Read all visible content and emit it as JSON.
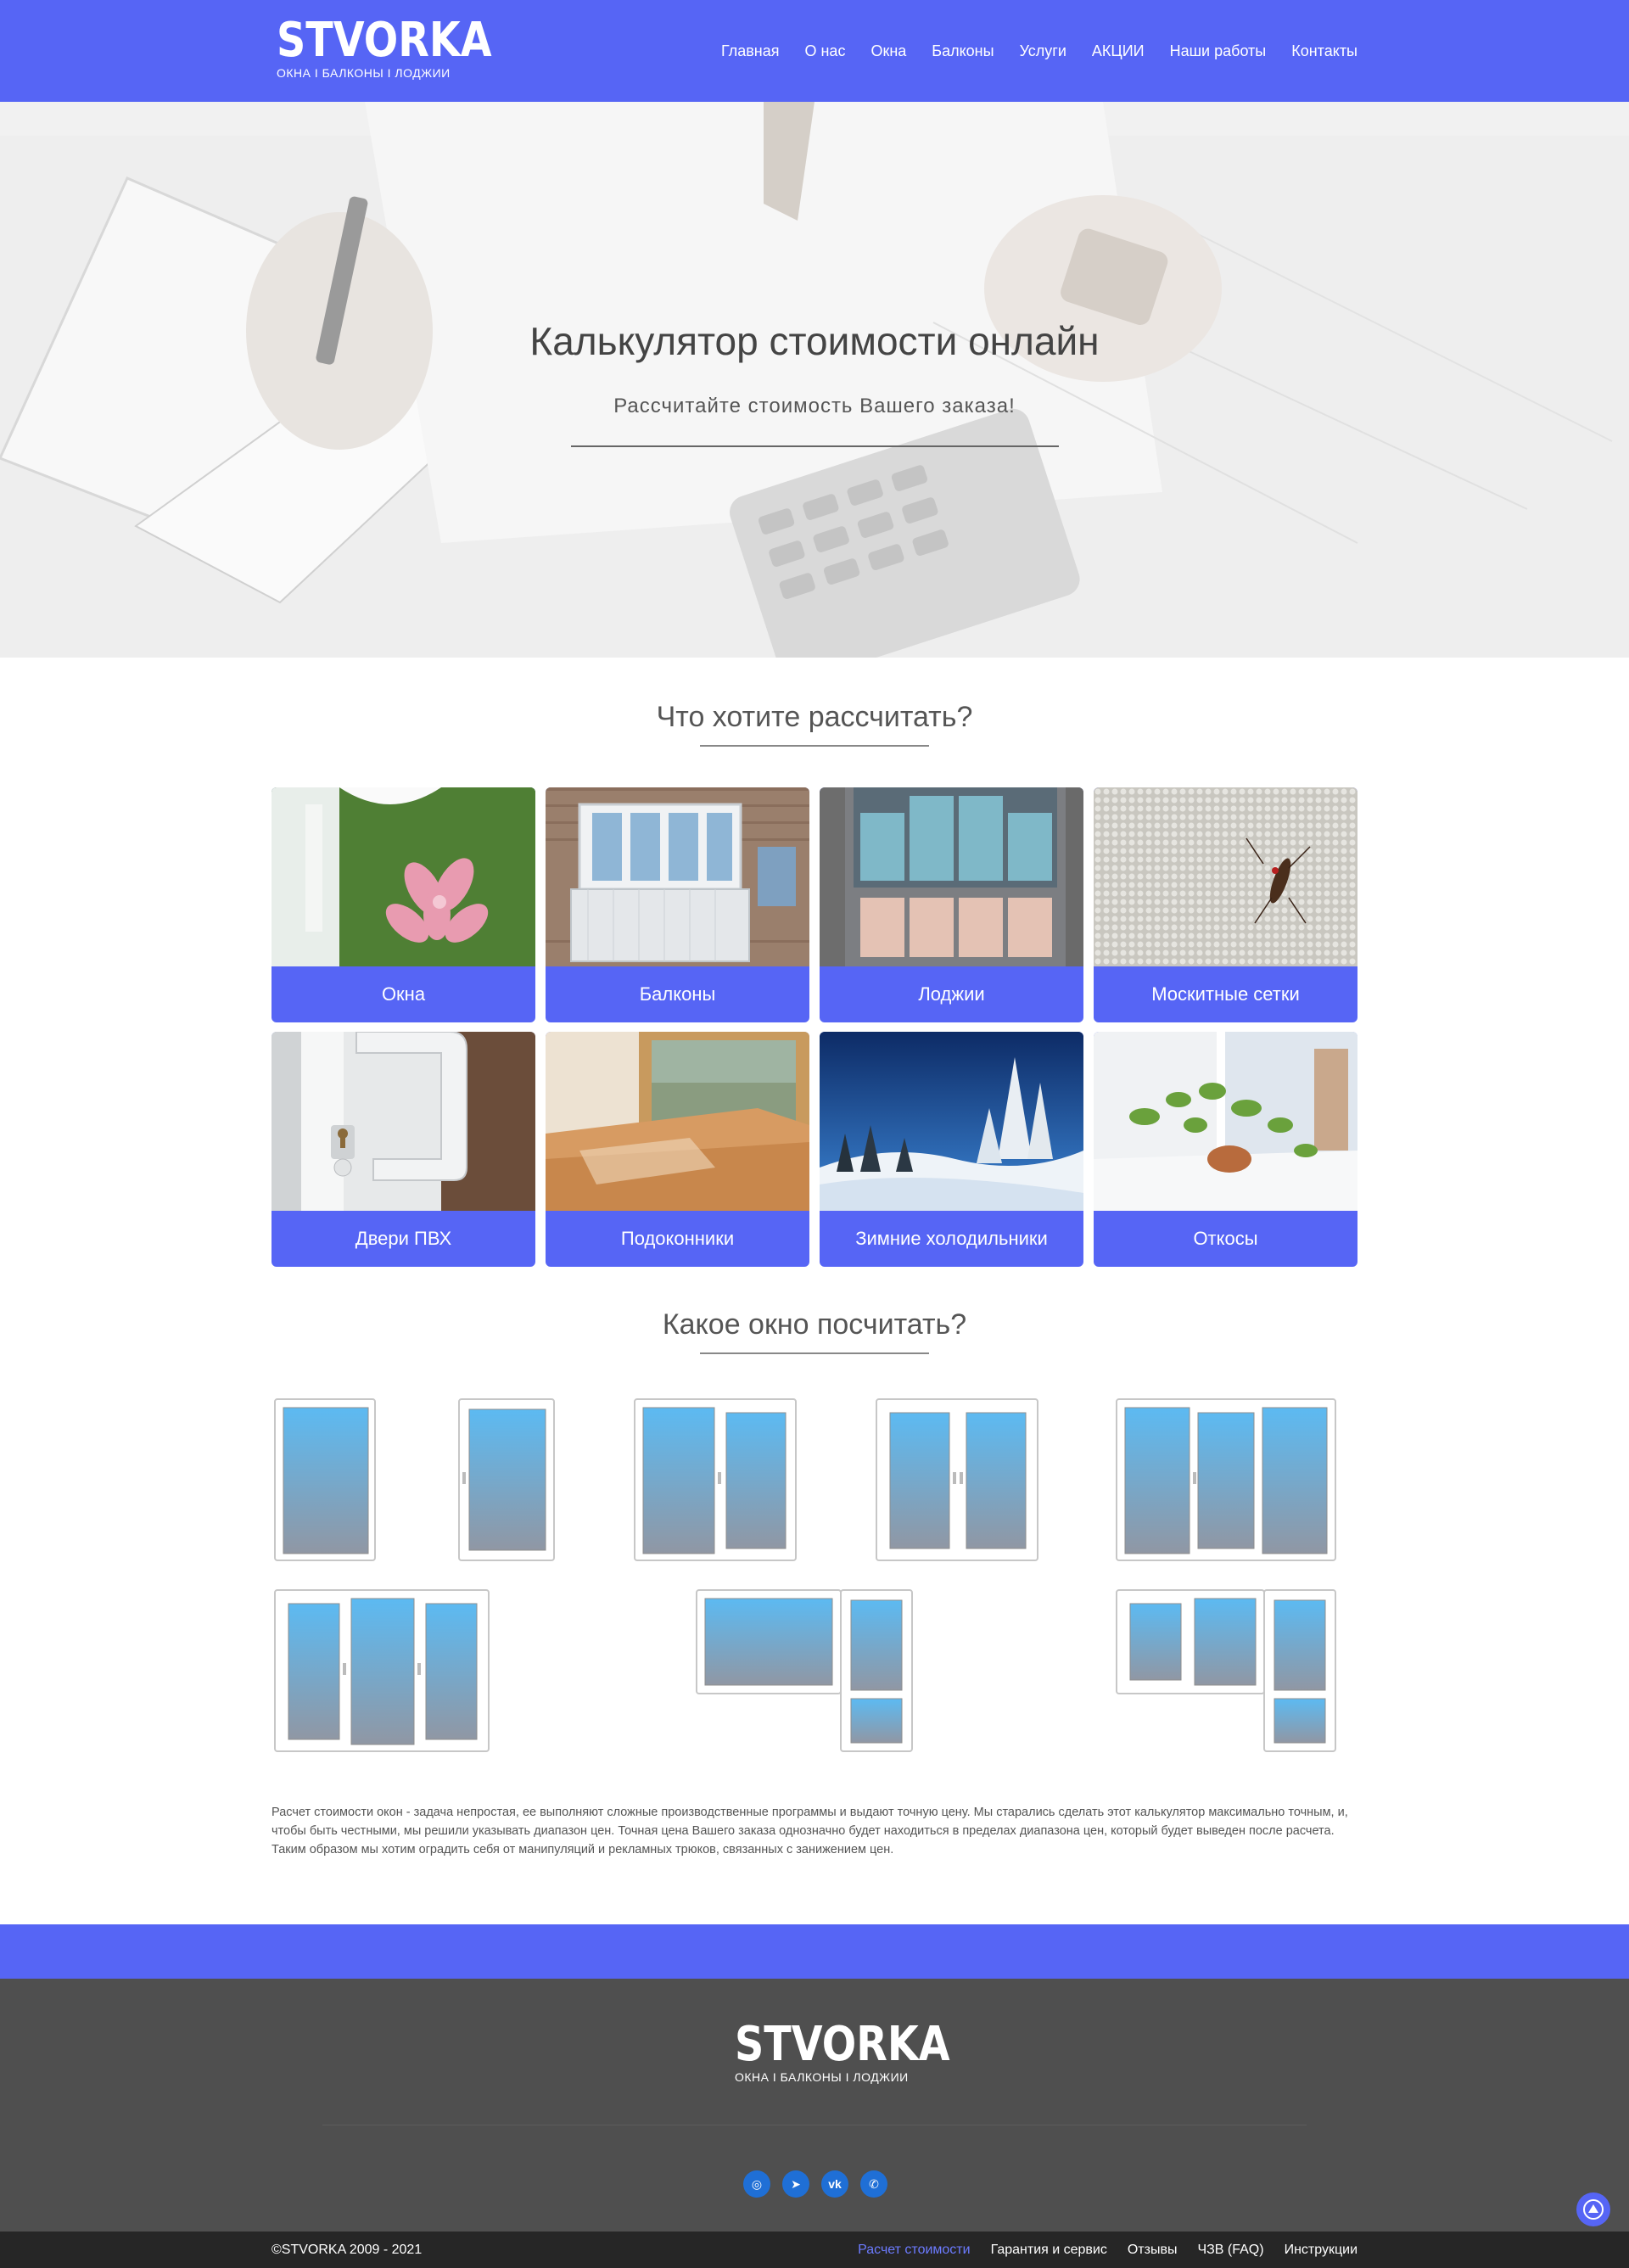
{
  "header": {
    "logo_text": "STVORKA",
    "logo_tagline": "ОКНА I БАЛКОНЫ I ЛОДЖИИ",
    "nav": [
      "Главная",
      "О нас",
      "Окна",
      "Балконы",
      "Услуги",
      "АКЦИИ",
      "Наши работы",
      "Контакты"
    ]
  },
  "hero": {
    "title": "Калькулятор стоимости онлайн",
    "subtitle": "Рассчитайте стоимость Вашего заказа!"
  },
  "products": {
    "title": "Что хотите рассчитать?",
    "items": [
      "Окна",
      "Балконы",
      "Лоджии",
      "Москитные сетки",
      "Двери ПВХ",
      "Подоконники",
      "Зимние холодильники",
      "Откосы"
    ]
  },
  "windows": {
    "title": "Какое окно посчитать?"
  },
  "description": "Расчет стоимости окон - задача непростая, ее выполняют сложные производственные программы и выдают точную цену. Мы старались сделать этот калькулятор максимально точным, и, чтобы быть честными, мы решили указывать диапазон цен. Точная цена Вашего заказа однозначно будет находиться в пределах диапазона цен, который будет выведен после расчета. Таким образом мы хотим оградить себя от манипуляций и рекламных трюков, связанных с занижением цен.",
  "footer": {
    "logo_text": "STVORKA",
    "logo_tagline": "ОКНА I БАЛКОНЫ I ЛОДЖИИ",
    "social_icons": [
      "instagram-icon",
      "telegram-icon",
      "vk-icon",
      "whatsapp-icon"
    ],
    "social_glyphs": [
      "◎",
      "➤",
      "vk",
      "✆"
    ],
    "copyright": "©STVORKA 2009 - 2021",
    "links": [
      "Расчет стоимости",
      "Гарантия и сервис",
      "Отзывы",
      "ЧЗВ (FAQ)",
      "Инструкции"
    ]
  },
  "colors": {
    "accent": "#5665f5",
    "footer": "#4f4f4f",
    "bottom_bar": "#262626",
    "social": "#1f6fd6"
  }
}
